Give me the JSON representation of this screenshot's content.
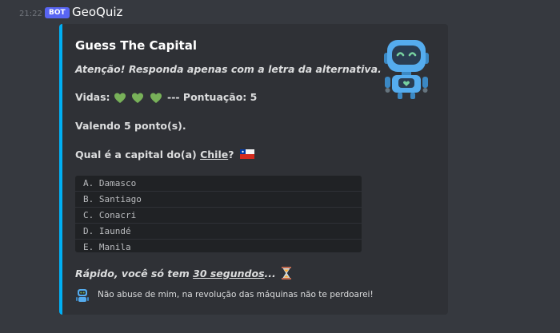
{
  "header": {
    "timestamp": "21:22",
    "bot_tag": "BOT",
    "username": "GeoQuiz"
  },
  "embed": {
    "accent_color": "#00aff4",
    "title": "Guess The Capital",
    "notice": "Atenção! Responda apenas com a letra da alternativa.",
    "lives_label": "Vidas:",
    "lives_count": 3,
    "score_text": "--- Pontuação: 5",
    "value_text": "Valendo 5 ponto(s).",
    "question_prefix": "Qual é a capital do(a)",
    "country": "Chile",
    "question_suffix": "?",
    "flag_icon": "chile-flag-icon",
    "options": [
      "A. Damasco",
      "B. Santiago",
      "C. Conacri",
      "D. Iaundé",
      "E. Manila"
    ],
    "timer_prefix": "Rápido, você só tem",
    "timer_value": "30 segundos",
    "timer_suffix": "...",
    "timer_icon": "hourglass-icon",
    "footer_text": "Não abuse de mim, na revolução das máquinas não te perdoarei!",
    "thumbnail_icon": "robot-icon"
  }
}
